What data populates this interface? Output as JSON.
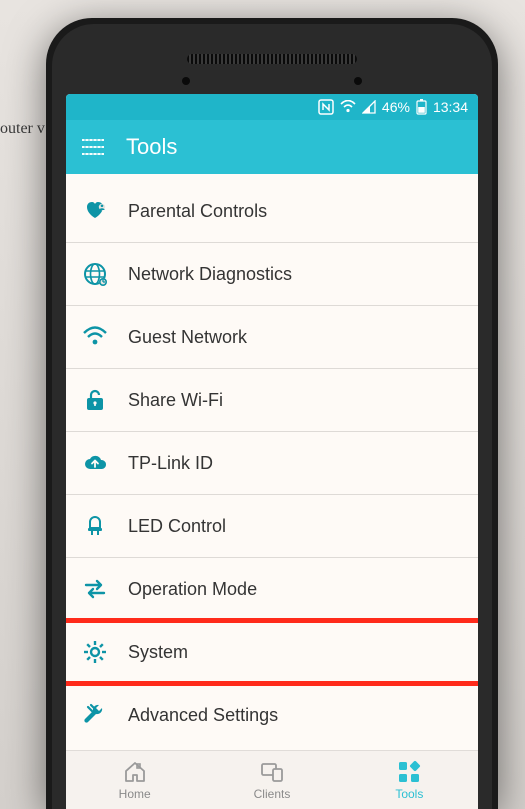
{
  "background": {
    "partial_text": "outer v"
  },
  "statusbar": {
    "battery_text": "46%",
    "time": "13:34"
  },
  "appbar": {
    "title": "Tools"
  },
  "menu": {
    "items": [
      {
        "id": "parental",
        "label": "Parental Controls"
      },
      {
        "id": "diag",
        "label": "Network Diagnostics"
      },
      {
        "id": "guest",
        "label": "Guest Network"
      },
      {
        "id": "sharewifi",
        "label": "Share Wi-Fi"
      },
      {
        "id": "tplinkid",
        "label": "TP-Link ID"
      },
      {
        "id": "led",
        "label": "LED Control"
      },
      {
        "id": "opmode",
        "label": "Operation Mode"
      },
      {
        "id": "system",
        "label": "System"
      },
      {
        "id": "advanced",
        "label": "Advanced Settings"
      }
    ],
    "highlighted_index": 7
  },
  "bottomnav": {
    "tabs": [
      {
        "id": "home",
        "label": "Home"
      },
      {
        "id": "clients",
        "label": "Clients"
      },
      {
        "id": "tools",
        "label": "Tools"
      }
    ],
    "active_index": 2
  },
  "colors": {
    "accent": "#2bc0d3",
    "icon_teal": "#0d94a6",
    "highlight": "#ff2a1a"
  }
}
